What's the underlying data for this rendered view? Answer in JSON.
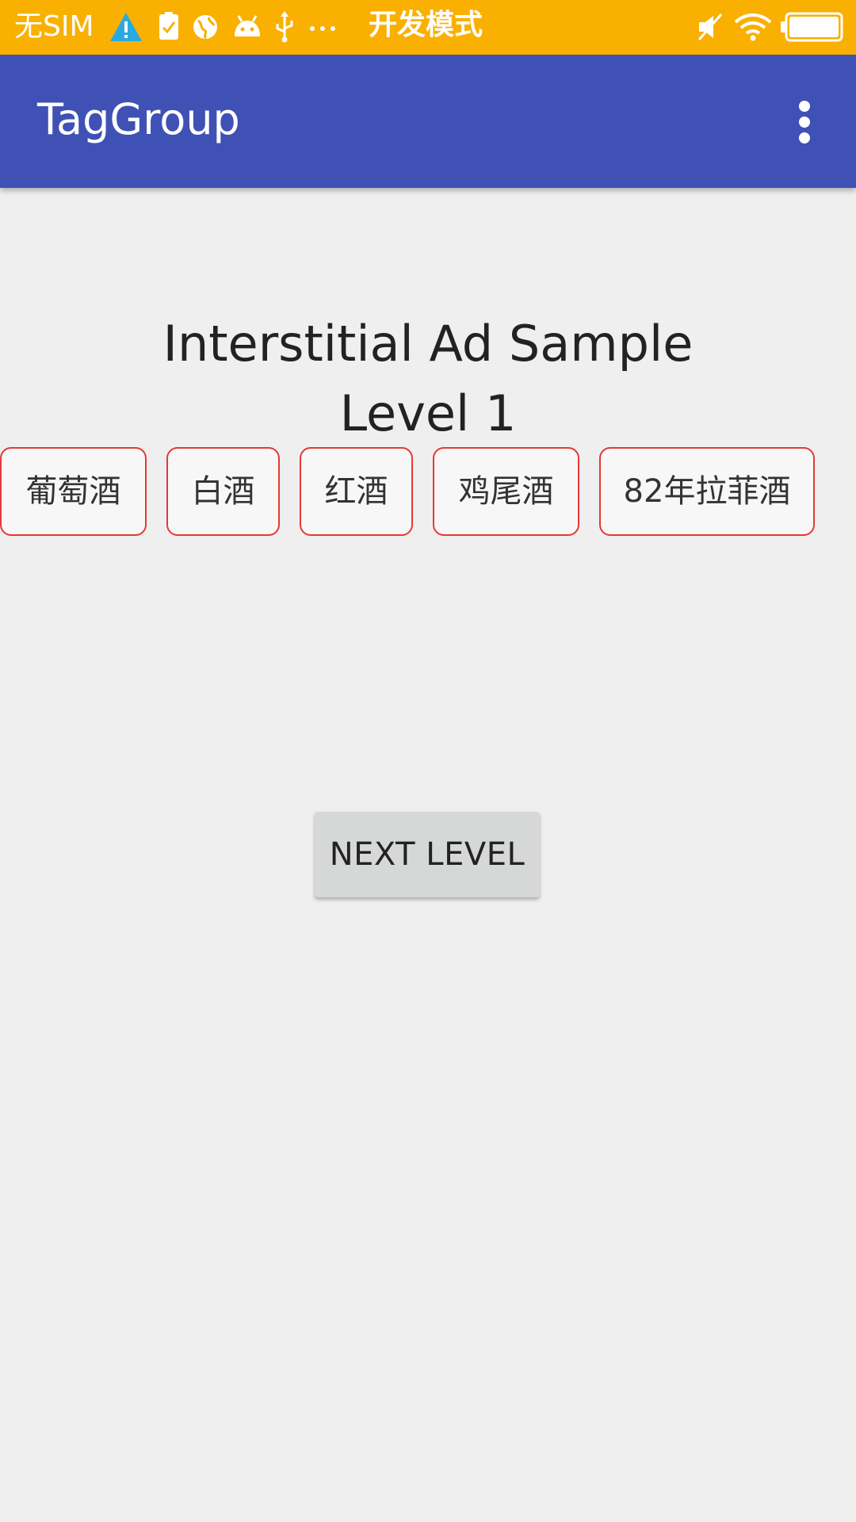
{
  "status_bar": {
    "carrier": "无SIM",
    "dev_mode": "开发模式",
    "icons": [
      "warning-icon",
      "task-check-icon",
      "globe-icon",
      "android-icon",
      "usb-icon",
      "more-dots-icon",
      "mute-icon",
      "wifi-icon",
      "battery-icon"
    ],
    "background_color": "#f9b000"
  },
  "app_bar": {
    "title": "TagGroup",
    "overflow_icon": "more-vert-icon",
    "background_color": "#3f51b5"
  },
  "content": {
    "heading_line1": "Interstitial Ad Sample",
    "heading_line2": "Level 1",
    "tags": [
      {
        "label": "葡萄酒"
      },
      {
        "label": "白酒"
      },
      {
        "label": "红酒"
      },
      {
        "label": "鸡尾酒"
      },
      {
        "label": "82年拉菲酒"
      }
    ],
    "tag_border_color": "#e53935",
    "next_button_label": "NEXT LEVEL"
  }
}
